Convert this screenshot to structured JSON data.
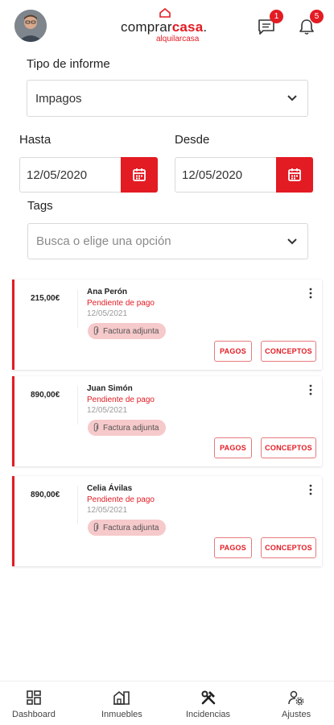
{
  "header": {
    "logo_brand_prefix": "comprar",
    "logo_brand_strong": "casa",
    "logo_brand_dot": ".",
    "logo_sub": "alquilarcasa",
    "messages_badge": "1",
    "notifications_badge": "5"
  },
  "filters": {
    "report_type_label": "Tipo de informe",
    "report_type_value": "Impagos",
    "to_label": "Hasta",
    "to_value": "12/05/2020",
    "from_label": "Desde",
    "from_value": "12/05/2020",
    "tags_label": "Tags",
    "tags_placeholder": "Busca o elige una opción"
  },
  "cards": [
    {
      "amount": "215,00€",
      "name": "Ana Perón",
      "status": "Pendiente de pago",
      "date": "12/05/2021",
      "chip": "Factura adjunta",
      "pagos": "PAGOS",
      "conceptos": "CONCEPTOS"
    },
    {
      "amount": "890,00€",
      "name": "Juan Simón",
      "status": "Pendiente de pago",
      "date": "12/05/2021",
      "chip": "Factura adjunta",
      "pagos": "PAGOS",
      "conceptos": "CONCEPTOS"
    },
    {
      "amount": "890,00€",
      "name": "Celia Ávilas",
      "status": "Pendiente de pago",
      "date": "12/05/2021",
      "chip": "Factura adjunta",
      "pagos": "PAGOS",
      "conceptos": "CONCEPTOS"
    }
  ],
  "nav": {
    "dashboard": "Dashboard",
    "inmuebles": "Inmuebles",
    "incidencias": "Incidencias",
    "ajustes": "Ajustes"
  },
  "colors": {
    "accent": "#e31b23",
    "chip_bg": "#f6c9cb"
  },
  "icons": [
    "chat-icon",
    "bell-icon",
    "chevron-down-icon",
    "calendar-icon",
    "paperclip-icon",
    "more-vertical-icon",
    "dashboard-icon",
    "building-icon",
    "tools-icon",
    "settings-user-icon"
  ]
}
